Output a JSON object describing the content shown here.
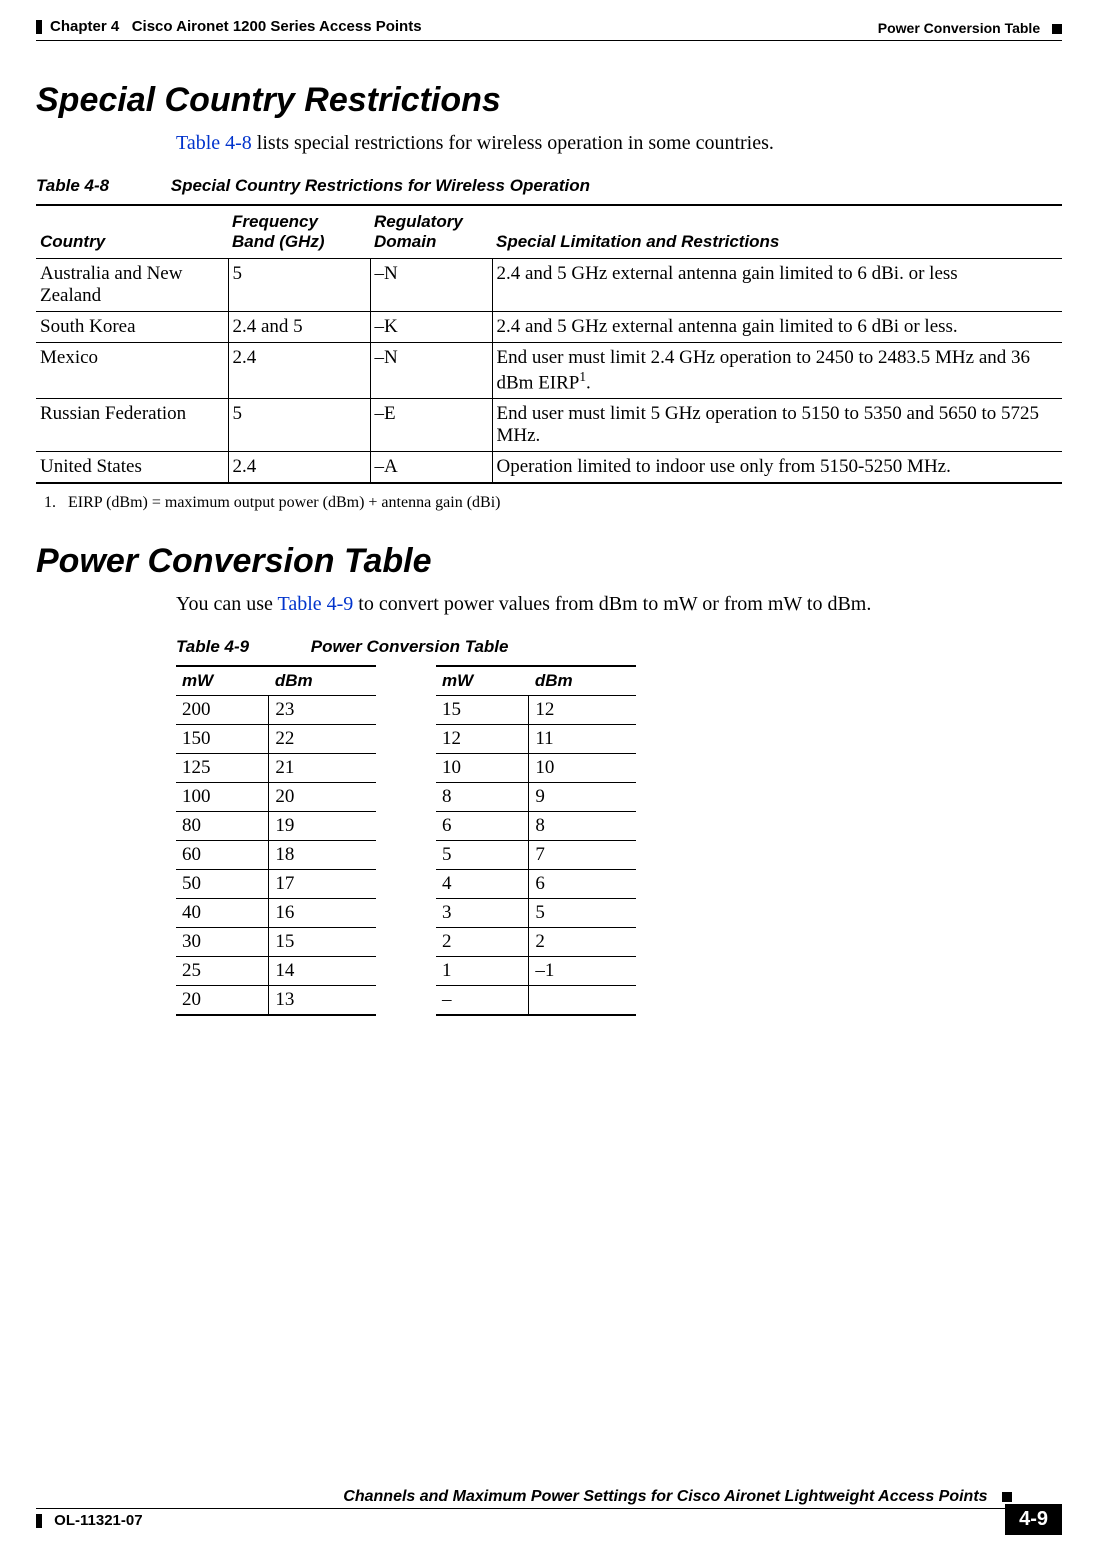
{
  "header": {
    "chapter": "Chapter 4",
    "title": "Cisco Aironet 1200 Series Access Points",
    "section": "Power Conversion Table"
  },
  "section1": {
    "heading": "Special Country Restrictions",
    "intro_link": "Table 4-8",
    "intro_rest": " lists special restrictions for wireless operation in some countries.",
    "caption_num": "Table 4-8",
    "caption_title": "Special Country Restrictions for Wireless Operation",
    "columns": {
      "c1": "Country",
      "c2": "Frequency Band (GHz)",
      "c3": "Regulatory Domain",
      "c4": "Special Limitation and Restrictions"
    },
    "rows": [
      {
        "country": "Australia and New Zealand",
        "freq": "5",
        "dom": "–N",
        "lim": "2.4 and 5 GHz external antenna gain limited to 6 dBi. or less"
      },
      {
        "country": "South Korea",
        "freq": "2.4 and 5",
        "dom": "–K",
        "lim": "2.4 and 5 GHz external antenna gain limited to 6 dBi or less."
      },
      {
        "country": "Mexico",
        "freq": "2.4",
        "dom": "–N",
        "lim": "End user must limit 2.4 GHz operation to 2450 to 2483.5 MHz and 36 dBm EIRP",
        "sup": "1",
        "lim_after": "."
      },
      {
        "country": "Russian Federation",
        "freq": "5",
        "dom": "–E",
        "lim": "End user must limit 5 GHz operation to 5150 to 5350 and 5650 to 5725 MHz."
      },
      {
        "country": "United States",
        "freq": "2.4",
        "dom": "–A",
        "lim": "Operation limited to indoor use only from 5150-5250 MHz."
      }
    ],
    "footnote_num": "1.",
    "footnote_text": "EIRP (dBm) = maximum output power (dBm) + antenna gain (dBi)"
  },
  "section2": {
    "heading": "Power Conversion Table",
    "intro_pre": "You can use ",
    "intro_link": "Table 4-9",
    "intro_post": " to convert power values from dBm to mW or from mW to dBm.",
    "caption_num": "Table 4-9",
    "caption_title": "Power Conversion Table",
    "headers": {
      "mw": "mW",
      "dbm": "dBm"
    },
    "left": [
      {
        "mw": "200",
        "dbm": "23"
      },
      {
        "mw": "150",
        "dbm": "22"
      },
      {
        "mw": "125",
        "dbm": "21"
      },
      {
        "mw": "100",
        "dbm": "20"
      },
      {
        "mw": "80",
        "dbm": "19"
      },
      {
        "mw": "60",
        "dbm": "18"
      },
      {
        "mw": "50",
        "dbm": "17"
      },
      {
        "mw": "40",
        "dbm": "16"
      },
      {
        "mw": "30",
        "dbm": "15"
      },
      {
        "mw": "25",
        "dbm": "14"
      },
      {
        "mw": "20",
        "dbm": "13"
      }
    ],
    "right": [
      {
        "mw": "15",
        "dbm": "12"
      },
      {
        "mw": "12",
        "dbm": "11"
      },
      {
        "mw": "10",
        "dbm": "10"
      },
      {
        "mw": "8",
        "dbm": "9"
      },
      {
        "mw": "6",
        "dbm": "8"
      },
      {
        "mw": "5",
        "dbm": "7"
      },
      {
        "mw": "4",
        "dbm": "6"
      },
      {
        "mw": "3",
        "dbm": "5"
      },
      {
        "mw": "2",
        "dbm": "2"
      },
      {
        "mw": "1",
        "dbm": "–1"
      },
      {
        "mw": "–",
        "dbm": ""
      }
    ]
  },
  "footer": {
    "doc_title": "Channels and Maximum Power Settings for Cisco Aironet Lightweight Access Points",
    "doc_id": "OL-11321-07",
    "page_num": "4-9"
  },
  "chart_data": [
    {
      "type": "table",
      "title": "Special Country Restrictions for Wireless Operation",
      "columns": [
        "Country",
        "Frequency Band (GHz)",
        "Regulatory Domain",
        "Special Limitation and Restrictions"
      ],
      "rows": [
        [
          "Australia and New Zealand",
          "5",
          "–N",
          "2.4 and 5 GHz external antenna gain limited to 6 dBi. or less"
        ],
        [
          "South Korea",
          "2.4 and 5",
          "–K",
          "2.4 and 5 GHz external antenna gain limited to 6 dBi or less."
        ],
        [
          "Mexico",
          "2.4",
          "–N",
          "End user must limit 2.4 GHz operation to 2450 to 2483.5 MHz and 36 dBm EIRP."
        ],
        [
          "Russian Federation",
          "5",
          "–E",
          "End user must limit 5 GHz operation to 5150 to 5350 and 5650 to 5725 MHz."
        ],
        [
          "United States",
          "2.4",
          "–A",
          "Operation limited to indoor use only from 5150-5250 MHz."
        ]
      ]
    },
    {
      "type": "table",
      "title": "Power Conversion Table",
      "columns": [
        "mW",
        "dBm"
      ],
      "rows": [
        [
          200,
          23
        ],
        [
          150,
          22
        ],
        [
          125,
          21
        ],
        [
          100,
          20
        ],
        [
          80,
          19
        ],
        [
          60,
          18
        ],
        [
          50,
          17
        ],
        [
          40,
          16
        ],
        [
          30,
          15
        ],
        [
          25,
          14
        ],
        [
          20,
          13
        ],
        [
          15,
          12
        ],
        [
          12,
          11
        ],
        [
          10,
          10
        ],
        [
          8,
          9
        ],
        [
          6,
          8
        ],
        [
          5,
          7
        ],
        [
          4,
          6
        ],
        [
          3,
          5
        ],
        [
          2,
          2
        ],
        [
          1,
          -1
        ]
      ]
    }
  ]
}
